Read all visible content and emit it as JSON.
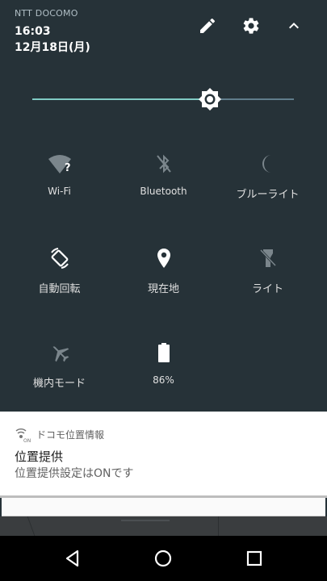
{
  "status": {
    "carrier": "NTT DOCOMO",
    "time": "16:03",
    "date": "12月18日(月)"
  },
  "header_icons": [
    {
      "icon": "pencil-icon",
      "name": "edit-button"
    },
    {
      "icon": "gear-icon",
      "name": "settings-button"
    },
    {
      "icon": "chevron-up-icon",
      "name": "collapse-button"
    }
  ],
  "brightness": {
    "level": 0.68,
    "fill_color": "#80cbc4",
    "track_color": "#607d8b"
  },
  "tiles": [
    {
      "label": "Wi-Fi",
      "icon": "wifi-unknown-icon",
      "active": false
    },
    {
      "label": "Bluetooth",
      "icon": "bluetooth-off-icon",
      "active": false
    },
    {
      "label": "ブルーライト",
      "icon": "moon-icon",
      "active": false
    },
    {
      "label": "自動回転",
      "icon": "auto-rotate-icon",
      "active": true
    },
    {
      "label": "現在地",
      "icon": "location-pin-icon",
      "active": true
    },
    {
      "label": "ライト",
      "icon": "flashlight-off-icon",
      "active": false
    },
    {
      "label": "機内モード",
      "icon": "airplane-icon",
      "active": false
    },
    {
      "label": "86%",
      "icon": "battery-icon",
      "active": true
    }
  ],
  "notification": {
    "app_icon": "location-signal-icon",
    "app_name": "ドコモ位置情報",
    "title": "位置提供",
    "text": "位置提供設定はONです"
  },
  "navbar": [
    {
      "icon": "back-triangle-icon",
      "name": "back-button"
    },
    {
      "icon": "home-circle-icon",
      "name": "home-button"
    },
    {
      "icon": "recents-square-icon",
      "name": "recents-button"
    }
  ],
  "colors": {
    "panel_bg": "#263238",
    "active_icon": "#ffffff",
    "inactive_icon": "#7b868c",
    "accent": "#80cbc4"
  }
}
